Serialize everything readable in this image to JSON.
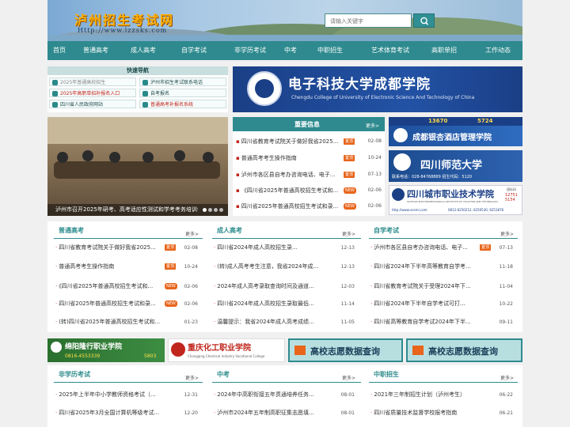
{
  "header": {
    "logo_text": "泸州招生考试网",
    "logo_url": "Http://www.lzzsks.com",
    "search_placeholder": "请输入关键字"
  },
  "nav": [
    "首页",
    "普通高考",
    "成人高考",
    "自学考试",
    "非学历考试",
    "中考",
    "中职招生",
    "艺术体育考试",
    "高职单招",
    "工作动态"
  ],
  "quick_nav": {
    "title": "快速导航",
    "items": [
      {
        "label": "2025年普通高校招生",
        "color": "#9aa"
      },
      {
        "label": "泸州市招生考试联系电话",
        "color": "#2a8a8a"
      },
      {
        "label": "2025年高职单招补报名入口",
        "color": "#c0261c"
      },
      {
        "label": "自考报名",
        "color": "#2a8a8a"
      },
      {
        "label": "四川省人民政府网站",
        "color": "#2a8a8a"
      },
      {
        "label": "普通高考补报名系统",
        "color": "#c0261c"
      }
    ]
  },
  "banner_main": {
    "cn": "电子科技大学成都学院",
    "en": "Chengdu College of University of Electronic Science And Technology of China"
  },
  "photo_caption": "泸州市召开2025年研考、高考适应性测试和学考考务培训会",
  "important": {
    "title": "重要信息",
    "more": "更多>",
    "items": [
      {
        "text": "四川省教育考试院关于做好我省2025...",
        "tag": "置顶",
        "date": "02-08"
      },
      {
        "text": "普通高考考生操作指南",
        "tag": "置顶",
        "date": "10-24"
      },
      {
        "text": "泸州市各区县自考办咨询电话、电子...",
        "tag": "置顶",
        "date": "07-13"
      },
      {
        "text": "《四川省2025年普通高校招生考试和...",
        "tag": "NEW",
        "date": "02-06"
      },
      {
        "text": "四川省2025年普通高校招生考试和录...",
        "tag": "NEW",
        "date": "02-06"
      }
    ]
  },
  "side_ads": [
    {
      "title": "成都银杏酒店管理学院",
      "top": "13670",
      "top2": "5724"
    },
    {
      "title": "四川师范大学",
      "phone": "联系电话：028-84768889 招生代码：5120"
    },
    {
      "title": "四川城市职业技术学院",
      "en": "SICHUAN ELECTROMECHANICAL INSTITUTE OF VOCATION AND TECHNOLOGY",
      "code": "12751 5154",
      "url": "http://www.scemi.com",
      "phone": "0812-6250212, 6250530, 6251876",
      "side_label": "国标码",
      "side_label2": "省代码"
    }
  ],
  "sections_row1": [
    {
      "title": "普通高考",
      "more": "更多>",
      "items": [
        {
          "text": "四川省教育考试院关于做好我省2025...",
          "tag": "置顶",
          "date": "02-08"
        },
        {
          "text": "普通高考考生操作指南",
          "tag": "置顶",
          "date": "10-24"
        },
        {
          "text": "《四川省2025年普通高校招生考试和...",
          "tag": "NEW",
          "date": "02-06"
        },
        {
          "text": "四川省2025年普通高校招生考试和录...",
          "tag": "NEW",
          "date": "02-06"
        },
        {
          "text": "(转)四川省2025年普通高校招生考试和...",
          "tag": "",
          "date": "01-23"
        }
      ]
    },
    {
      "title": "成人高考",
      "more": "更多>",
      "items": [
        {
          "text": "四川省2024年成人高校招生录...",
          "tag": "",
          "date": "12-13"
        },
        {
          "text": "(转)成人高考考生注意，我省2024年成...",
          "tag": "",
          "date": "12-13"
        },
        {
          "text": "2024年成人高考录取查询时间及通道...",
          "tag": "",
          "date": "12-03"
        },
        {
          "text": "四川省2024年成人高校招生录取最低...",
          "tag": "",
          "date": "11-14"
        },
        {
          "text": "温馨提示：我省2024年成人高考成绩...",
          "tag": "",
          "date": "11-05"
        }
      ]
    },
    {
      "title": "自学考试",
      "more": "更多>",
      "items": [
        {
          "text": "泸州市各区县自考办咨询电话、电子...",
          "tag": "置顶",
          "date": "07-13"
        },
        {
          "text": "四川省2024年下半年高等教育自学考...",
          "tag": "",
          "date": "11-18"
        },
        {
          "text": "四川省教育考试院关于受理2024年下...",
          "tag": "",
          "date": "11-04"
        },
        {
          "text": "四川省2024年下半年自学考试可打...",
          "tag": "",
          "date": "10-22"
        },
        {
          "text": "四川省高等教育自学考试2024年下半...",
          "tag": "",
          "date": "09-11"
        }
      ]
    }
  ],
  "mid_banners": [
    {
      "title": "绵阳隆行职业学院",
      "phone": "0816-4553339",
      "code": "5803"
    },
    {
      "title": "重庆化工职业学院",
      "en": "Chongqing Chemical Industry Vocational College"
    },
    {
      "title": "高校志愿数据查询"
    },
    {
      "title": "高校志愿数据查询"
    }
  ],
  "sections_row2": [
    {
      "title": "非学历考试",
      "more": "更多>",
      "items": [
        {
          "text": "2025年上半年中小学教师资格考试（...",
          "date": "12-31"
        },
        {
          "text": "四川省2025年3月全国计算机等级考试...",
          "date": "12-20"
        }
      ]
    },
    {
      "title": "中考",
      "more": "更多>",
      "items": [
        {
          "text": "2024年中高职衔接五年贯通培养任务...",
          "date": "08-01"
        },
        {
          "text": "泸州市2024年五年制高职征集志愿填...",
          "date": "08-01"
        }
      ]
    },
    {
      "title": "中职招生",
      "more": "更多>",
      "items": [
        {
          "text": "2021年三年制招生计划（泸州考生）",
          "date": "06-22"
        },
        {
          "text": "四川省质量技术监督学校报考指南",
          "date": "06-21"
        }
      ]
    }
  ],
  "colors": {
    "teal": "#2e8a8e",
    "red": "#c0261c",
    "orange": "#e8651b",
    "navy": "#1a3f86"
  }
}
